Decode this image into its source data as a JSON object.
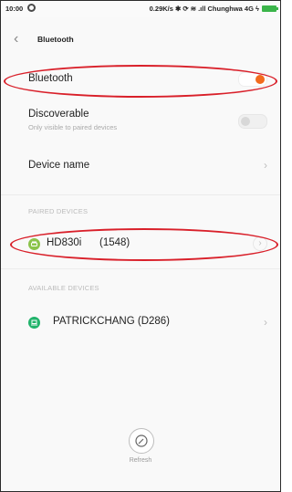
{
  "status_bar": {
    "time": "10:00",
    "right_text": "0.29K/s ✱ ⟳ ≋ .ıll Chunghwa 4G ϟ"
  },
  "header": {
    "title": "Bluetooth"
  },
  "settings": {
    "bluetooth": {
      "label": "Bluetooth",
      "enabled": true
    },
    "discoverable": {
      "label": "Discoverable",
      "subtitle": "Only visible to paired devices",
      "enabled": false
    },
    "device_name": {
      "label": "Device name"
    }
  },
  "paired": {
    "header": "PAIRED DEVICES",
    "devices": [
      {
        "name": "HD830i",
        "code": "(1548)",
        "icon": "headset-icon",
        "icon_color": "#8bc34a"
      }
    ]
  },
  "available": {
    "header": "AVAILABLE DEVICES",
    "devices": [
      {
        "name": "PATRICKCHANG (D286)",
        "icon": "laptop-icon",
        "icon_color": "#21b36b"
      }
    ]
  },
  "footer": {
    "refresh_label": "Refresh"
  },
  "colors": {
    "accent": "#f26b1d",
    "annotation": "#d9202a"
  }
}
